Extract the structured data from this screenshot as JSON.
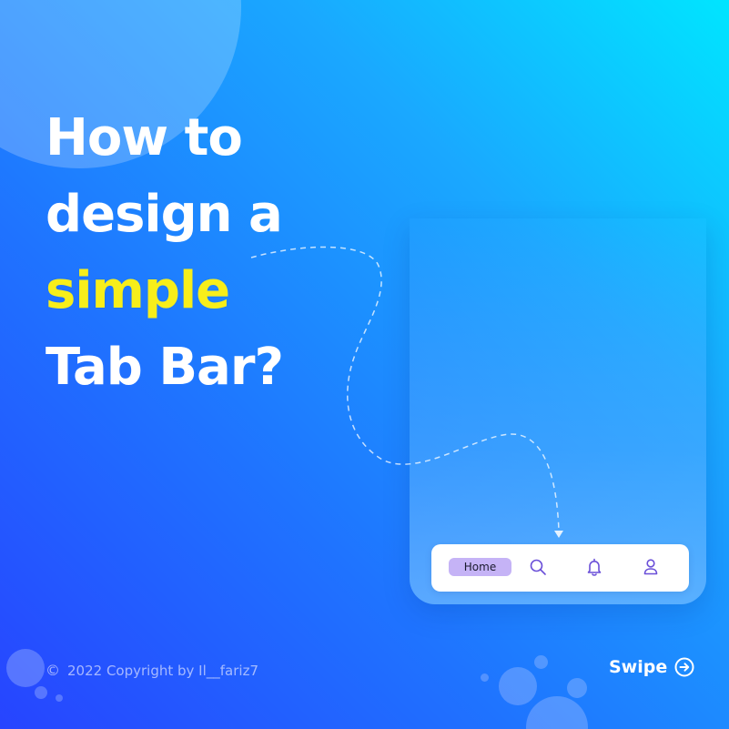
{
  "headline": {
    "line1": "How to",
    "line2": "design a",
    "line3": "simple",
    "line4": "Tab Bar?"
  },
  "tab_bar": {
    "active_tab": "Home",
    "tabs": [
      {
        "label": "Home",
        "icon": "home"
      },
      {
        "label": "",
        "icon": "search-icon"
      },
      {
        "label": "",
        "icon": "bell-icon"
      },
      {
        "label": "",
        "icon": "user-icon"
      }
    ],
    "active_color": "#c5b3f6",
    "icon_color": "#6a4fd8"
  },
  "footer": {
    "copyright_symbol": "©",
    "copyright_text": "2022 Copyright by Il__fariz7",
    "swipe_label": "Swipe"
  },
  "colors": {
    "accent": "#f7ee1a",
    "gradient_start": "#00e5ff",
    "gradient_end": "#2744ff",
    "text": "#ffffff"
  }
}
